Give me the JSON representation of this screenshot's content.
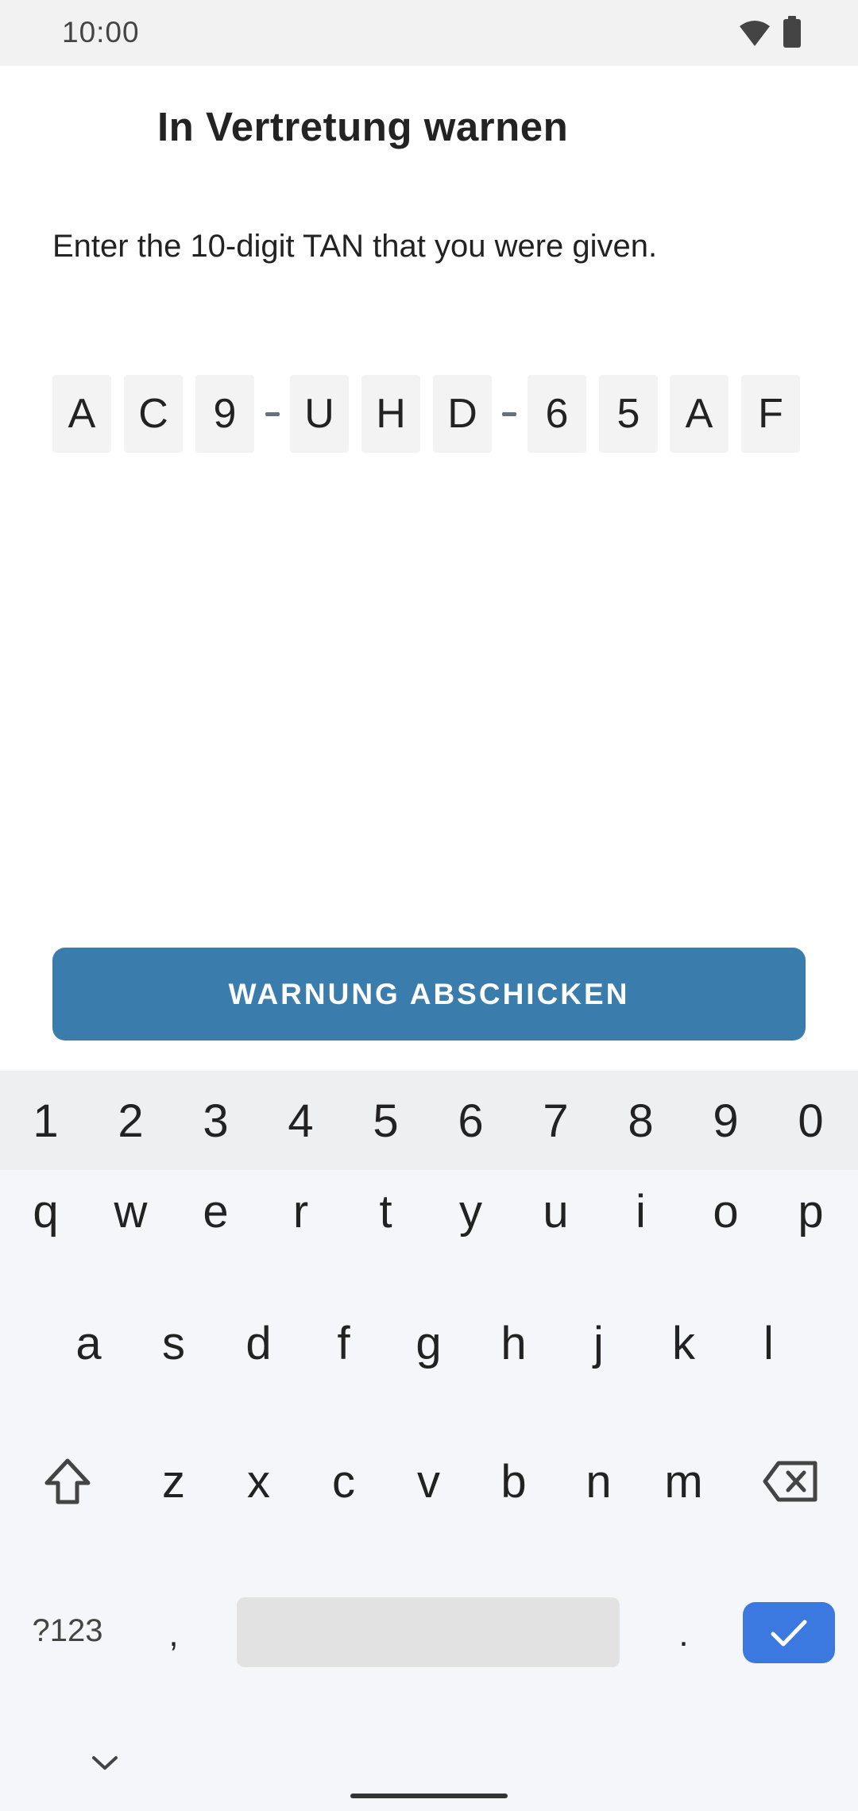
{
  "status_bar": {
    "time": "10:00"
  },
  "header": {
    "title": "In Vertretung warnen"
  },
  "main": {
    "instruction": "Enter the 10-digit TAN that you were given.",
    "tan_chars": [
      "A",
      "C",
      "9",
      "U",
      "H",
      "D",
      "6",
      "5",
      "A",
      "F"
    ],
    "submit_label": "WARNUNG ABSCHICKEN"
  },
  "keyboard": {
    "numbers": [
      "1",
      "2",
      "3",
      "4",
      "5",
      "6",
      "7",
      "8",
      "9",
      "0"
    ],
    "row1": [
      "q",
      "w",
      "e",
      "r",
      "t",
      "y",
      "u",
      "i",
      "o",
      "p"
    ],
    "row2": [
      "a",
      "s",
      "d",
      "f",
      "g",
      "h",
      "j",
      "k",
      "l"
    ],
    "row3": [
      "z",
      "x",
      "c",
      "v",
      "b",
      "n",
      "m"
    ],
    "symbols_label": "?123",
    "comma": ",",
    "period": "."
  },
  "colors": {
    "accent": "#3a7cab",
    "enter": "#3b78e0"
  }
}
